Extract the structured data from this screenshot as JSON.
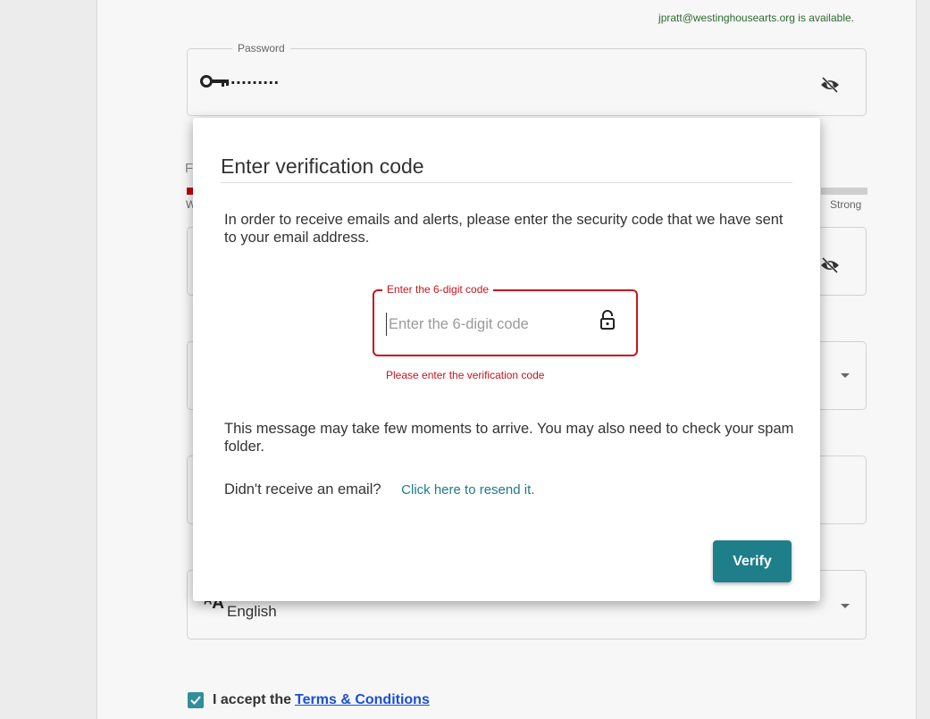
{
  "background": {
    "availability_message": "jpratt@westinghousearts.org is available.",
    "password_field": {
      "label": "Password",
      "value_masked": "..........",
      "icon": "key-icon",
      "toggle_icon": "eye-off-icon"
    },
    "strength_meter": {
      "partial_label": "F",
      "weak_label": "W",
      "strong_label": "Strong",
      "level_color": "#c00000"
    },
    "language_field": {
      "icon": "translate-icon",
      "icon_glyph": "ᴬA",
      "value": "English"
    },
    "terms": {
      "checked": true,
      "prefix": "I accept the",
      "link_text": "Terms & Conditions"
    }
  },
  "modal": {
    "title": "Enter verification code",
    "intro": "In order to receive emails and alerts, please enter the security code that we have sent to your email address.",
    "code_field": {
      "label": "Enter the 6-digit code",
      "placeholder": "Enter the 6-digit code",
      "value": "",
      "error": "Please enter the verification code",
      "icon": "lock-icon"
    },
    "note": "This message may take few moments to arrive. You may also need to check your spam folder.",
    "resend_prompt": "Didn't receive an email?",
    "resend_link": "Click here to resend it.",
    "verify_label": "Verify"
  },
  "colors": {
    "accent": "#1e7f8a",
    "error": "#c4161c",
    "link": "#1a4fd6",
    "available": "#2e6b2e"
  }
}
